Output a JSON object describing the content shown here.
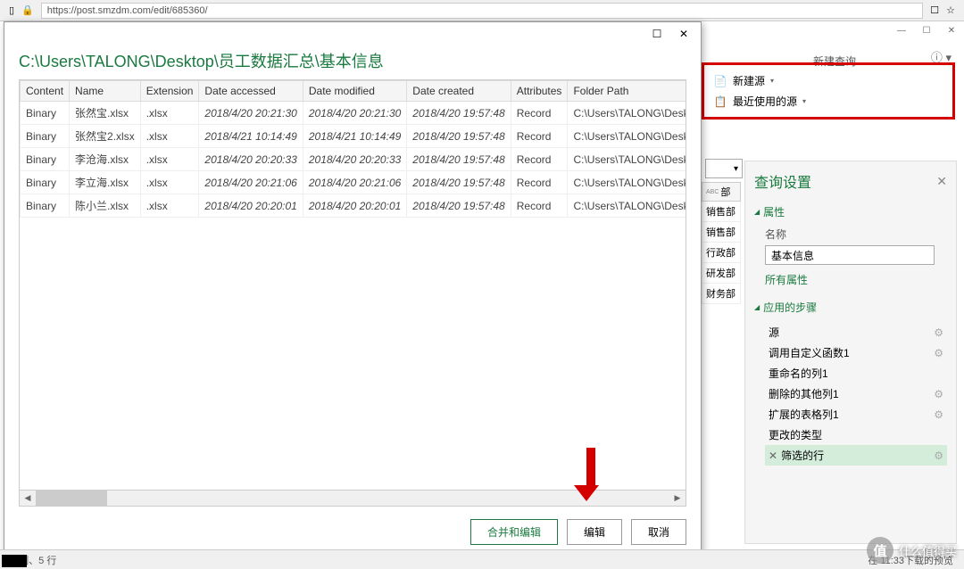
{
  "browser": {
    "url": "https://post.smzdm.com/edit/685360/"
  },
  "window_controls": {
    "min": "—",
    "max": "☐",
    "close": "✕"
  },
  "dialog": {
    "path": "C:\\Users\\TALONG\\Desktop\\员工数据汇总\\基本信息",
    "columns": [
      "Content",
      "Name",
      "Extension",
      "Date accessed",
      "Date modified",
      "Date created",
      "Attributes",
      "Folder Path"
    ],
    "rows": [
      {
        "c": "Binary",
        "n": "张然宝.xlsx",
        "e": ".xlsx",
        "da": "2018/4/20 20:21:30",
        "dm": "2018/4/20 20:21:30",
        "dc": "2018/4/20 19:57:48",
        "a": "Record",
        "fp": "C:\\Users\\TALONG\\Desktop\\员工数据汇总"
      },
      {
        "c": "Binary",
        "n": "张然宝2.xlsx",
        "e": ".xlsx",
        "da": "2018/4/21 10:14:49",
        "dm": "2018/4/21 10:14:49",
        "dc": "2018/4/20 19:57:48",
        "a": "Record",
        "fp": "C:\\Users\\TALONG\\Desktop\\员工数据汇总"
      },
      {
        "c": "Binary",
        "n": "李沧海.xlsx",
        "e": ".xlsx",
        "da": "2018/4/20 20:20:33",
        "dm": "2018/4/20 20:20:33",
        "dc": "2018/4/20 19:57:48",
        "a": "Record",
        "fp": "C:\\Users\\TALONG\\Desktop\\员工数据汇总"
      },
      {
        "c": "Binary",
        "n": "李立海.xlsx",
        "e": ".xlsx",
        "da": "2018/4/20 20:21:06",
        "dm": "2018/4/20 20:21:06",
        "dc": "2018/4/20 19:57:48",
        "a": "Record",
        "fp": "C:\\Users\\TALONG\\Desktop\\员工数据汇总"
      },
      {
        "c": "Binary",
        "n": "陈小兰.xlsx",
        "e": ".xlsx",
        "da": "2018/4/20 20:20:01",
        "dm": "2018/4/20 20:20:01",
        "dc": "2018/4/20 19:57:48",
        "a": "Record",
        "fp": "C:\\Users\\TALONG\\Desktop\\员工数据汇总"
      }
    ],
    "btn_combine": "合并和编辑",
    "btn_edit": "编辑",
    "btn_cancel": "取消"
  },
  "ribbon": {
    "new_source": "新建源",
    "recent_sources": "最近使用的源",
    "group_label": "新建查询"
  },
  "preview": {
    "col_header_icon": "ABC",
    "col_header": "部",
    "cells": [
      "销售部",
      "销售部",
      "行政部",
      "研发部",
      "财务部"
    ]
  },
  "settings": {
    "title": "查询设置",
    "section_props": "属性",
    "label_name": "名称",
    "value_name": "基本信息",
    "link_all_props": "所有属性",
    "section_steps": "应用的步骤",
    "steps": [
      "源",
      "调用自定义函数1",
      "重命名的列1",
      "删除的其他列1",
      "扩展的表格列1",
      "更改的类型",
      "筛选的行"
    ]
  },
  "status": {
    "left": "9 列、5 行",
    "right": "在 11:33下载的预览"
  },
  "watermark": "什么值得买"
}
